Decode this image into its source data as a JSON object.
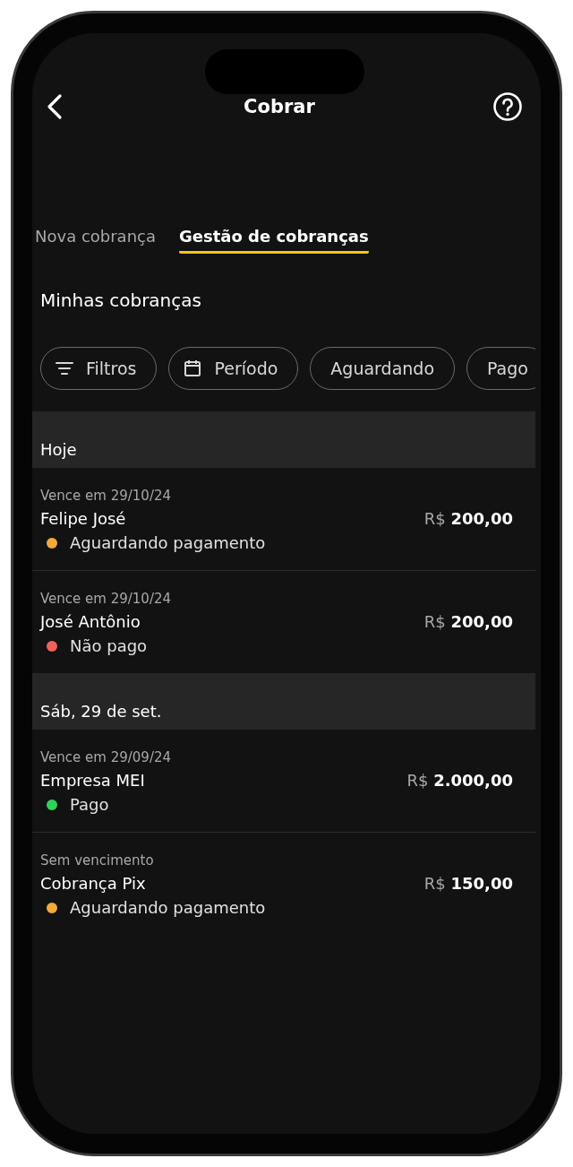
{
  "header": {
    "title": "Cobrar"
  },
  "tabs": [
    {
      "label": "Nova cobrança",
      "selected": false
    },
    {
      "label": "Gestão de cobranças",
      "selected": true
    }
  ],
  "section_title": "Minhas cobranças",
  "chips": [
    {
      "label": "Filtros",
      "kind": "filter"
    },
    {
      "label": "Período",
      "kind": "calendar"
    },
    {
      "label": "Aguardando",
      "kind": "plain"
    },
    {
      "label": "Pago",
      "kind": "plain"
    }
  ],
  "groups": [
    {
      "heading": "Hoje",
      "items": [
        {
          "due": "Vence em 29/10/24",
          "name": "Felipe José",
          "currency": "R$",
          "amount": "200,00",
          "status": "Aguardando pagamento",
          "color": "#f5a93a"
        },
        {
          "due": "Vence em 29/10/24",
          "name": "José Antônio",
          "currency": "R$",
          "amount": "200,00",
          "status": "Não pago",
          "color": "#f0625c"
        }
      ]
    },
    {
      "heading": "Sáb, 29 de set.",
      "items": [
        {
          "due": "Vence em 29/09/24",
          "name": "Empresa MEI",
          "currency": "R$",
          "amount": "2.000,00",
          "status": "Pago",
          "color": "#2fd15a"
        },
        {
          "due": "Sem vencimento",
          "name": "Cobrança Pix",
          "currency": "R$",
          "amount": "150,00",
          "status": "Aguardando pagamento",
          "color": "#f5a93a"
        }
      ]
    }
  ]
}
